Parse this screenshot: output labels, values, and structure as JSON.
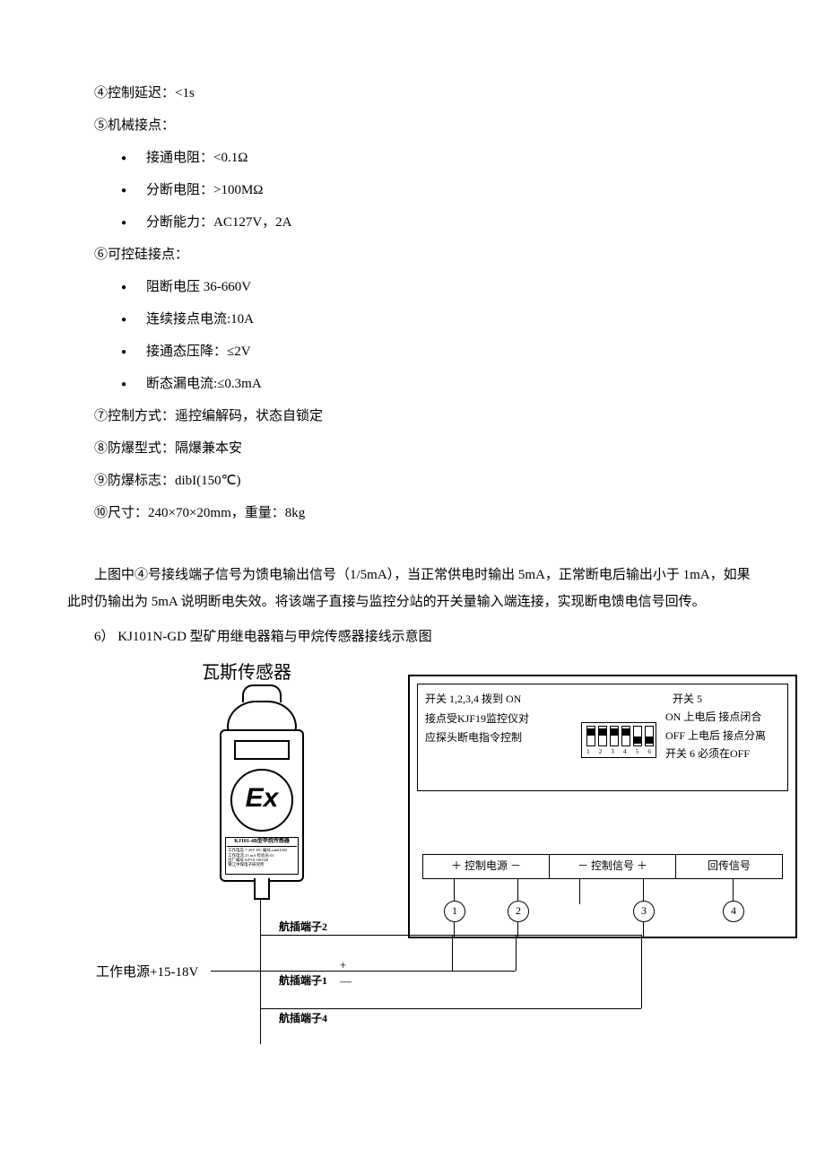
{
  "specs": {
    "l4": "④控制延迟：<1s",
    "l5": "⑤机械接点：",
    "b5a": "接通电阻：<0.1Ω",
    "b5b": "分断电阻：>100MΩ",
    "b5c": "分断能力：AC127V，2A",
    "l6": "⑥可控硅接点：",
    "b6a": "阻断电压 36-660V",
    "b6b": "连续接点电流:10A",
    "b6c": "接通态压降：≤2V",
    "b6d": "断态漏电流:≤0.3mA",
    "l7": "⑦控制方式：遥控编解码，状态自锁定",
    "l8": "⑧防爆型式：隔爆兼本安",
    "l9": "⑨防爆标志：dibI(150℃)",
    "l10": "⑩尺寸：240×70×20mm，重量：8kg"
  },
  "paragraph": "上图中④号接线端子信号为馈电输出信号（1/5mA），当正常供电时输出 5mA，正常断电后输出小于 1mA，如果此时仍输出为 5mA 说明断电失效。将该端子直接与监控分站的开关量输入端连接，实现断电馈电信号回传。",
  "section6": "6） KJ101N-GD 型矿用继电器箱与甲烷传感器接线示意图",
  "diagram": {
    "sensor_title": "瓦斯传感器",
    "sensor_label_title": "KJ101-4B型甲烷传感器",
    "sensor_label_small": "工作电压 7-20V DC 编号:mk01003\n工作电流 25 mA 检验员:01\n出厂编号 KP-01-08-028\n镇江中煤电子研究所",
    "ex": "Ex",
    "colA1": "开关 1,2,3,4 拨到 ON",
    "colA2": "接点受KJF19监控仪对",
    "colA3": "应探头断电指令控制",
    "colB1": "开关 5",
    "colB2": "ON  上电后   接点闭合",
    "colB3": "OFF 上电后  接点分离",
    "colB4": "开关  6 必须在OFF",
    "dip_nums": [
      "1",
      "2",
      "3",
      "4",
      "5",
      "6"
    ],
    "term1": "＋ 控制电源 －",
    "term2": "－ 控制信号 ＋",
    "term3": "回传信号",
    "n1": "1",
    "n2": "2",
    "n3": "3",
    "n4": "4",
    "wire2": "航插端子2",
    "wire1": "航插端子1",
    "wire4": "航插端子4",
    "psu": "工作电源+15-18V",
    "plus": "+",
    "minus": "—"
  }
}
